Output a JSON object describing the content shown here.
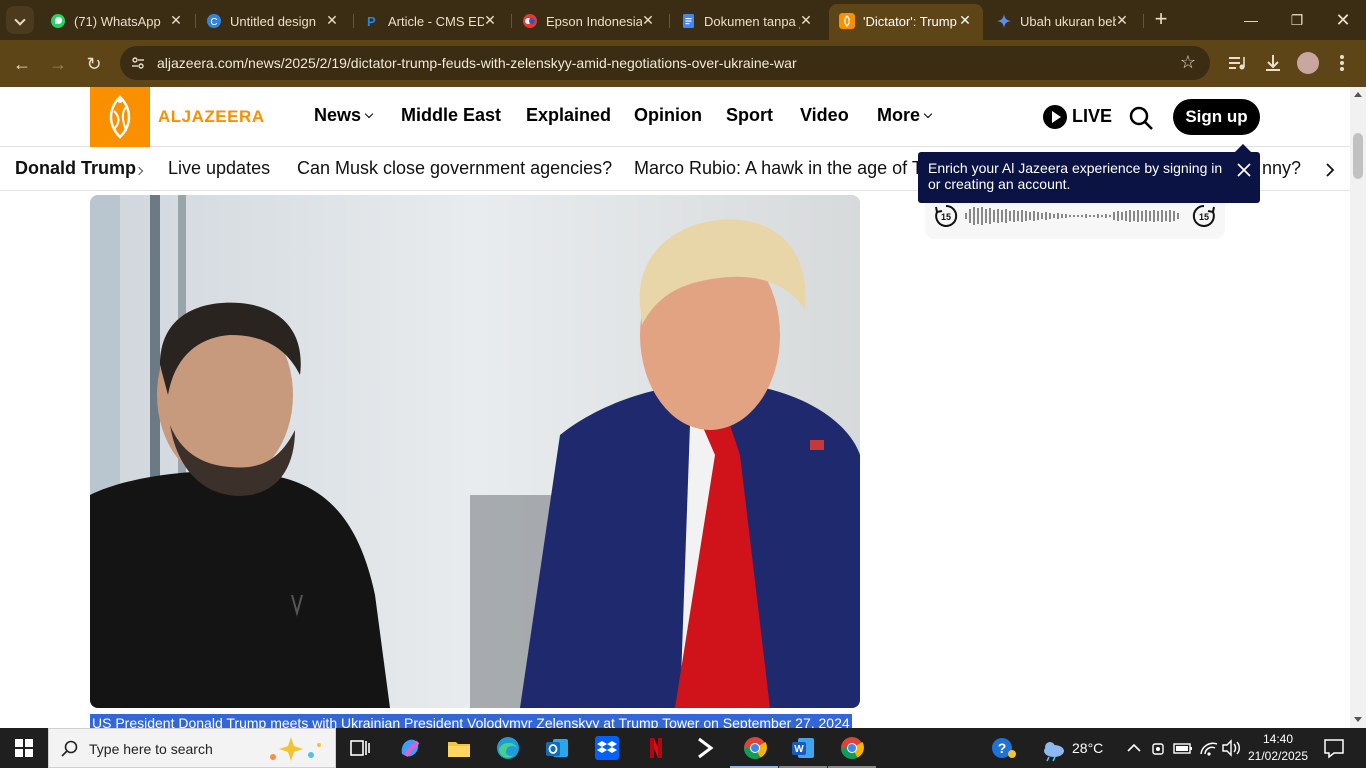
{
  "browser": {
    "tabs": [
      {
        "title": "(71) WhatsApp",
        "icon": "whatsapp-icon",
        "color": "#25d366",
        "active": false
      },
      {
        "title": "Untitled design",
        "icon": "canva-icon",
        "color": "#00c4cc",
        "active": false
      },
      {
        "title": "Article - CMS EDU",
        "icon": "p-icon",
        "color": "#1e88e5",
        "active": false
      },
      {
        "title": "Epson Indonesia",
        "icon": "epson-icon",
        "color": "#3f51b5",
        "active": false
      },
      {
        "title": "Dokumen tanpa judul",
        "icon": "docs-icon",
        "color": "#4285f4",
        "active": false
      },
      {
        "title": "'Dictator': Trump feuds",
        "icon": "aljazeera-icon",
        "color": "#fa9000",
        "active": true
      },
      {
        "title": "Ubah ukuran bebas",
        "icon": "gemini-icon",
        "color": "#5b8def",
        "active": false
      }
    ],
    "url": "aljazeera.com/news/2025/2/19/dictator-trump-feuds-with-zelenskyy-amid-negotiations-over-ukraine-war"
  },
  "site": {
    "logo_text": "ALJAZEERA",
    "nav": [
      "News",
      "Middle East",
      "Explained",
      "Opinion",
      "Sport",
      "Video",
      "More"
    ],
    "live_label": "LIVE",
    "signup_label": "Sign up",
    "topics": [
      "Donald Trump",
      "Live updates",
      "Can Musk close government agencies?",
      "Marco Rubio: A hawk in the age of Trump",
      "nny?"
    ],
    "tooltip": "Enrich your Al Jazeera experience by signing in or creating an account.",
    "audio_skip_back": "15",
    "audio_skip_fwd": "15",
    "caption": "US President Donald Trump meets with Ukrainian President Volodymyr Zelenskyy at Trump Tower on September 27, 2024",
    "brand_color": "#fa9000"
  },
  "taskbar": {
    "search_placeholder": "Type here to search",
    "weather": "28°C",
    "time": "14:40",
    "date": "21/02/2025"
  }
}
